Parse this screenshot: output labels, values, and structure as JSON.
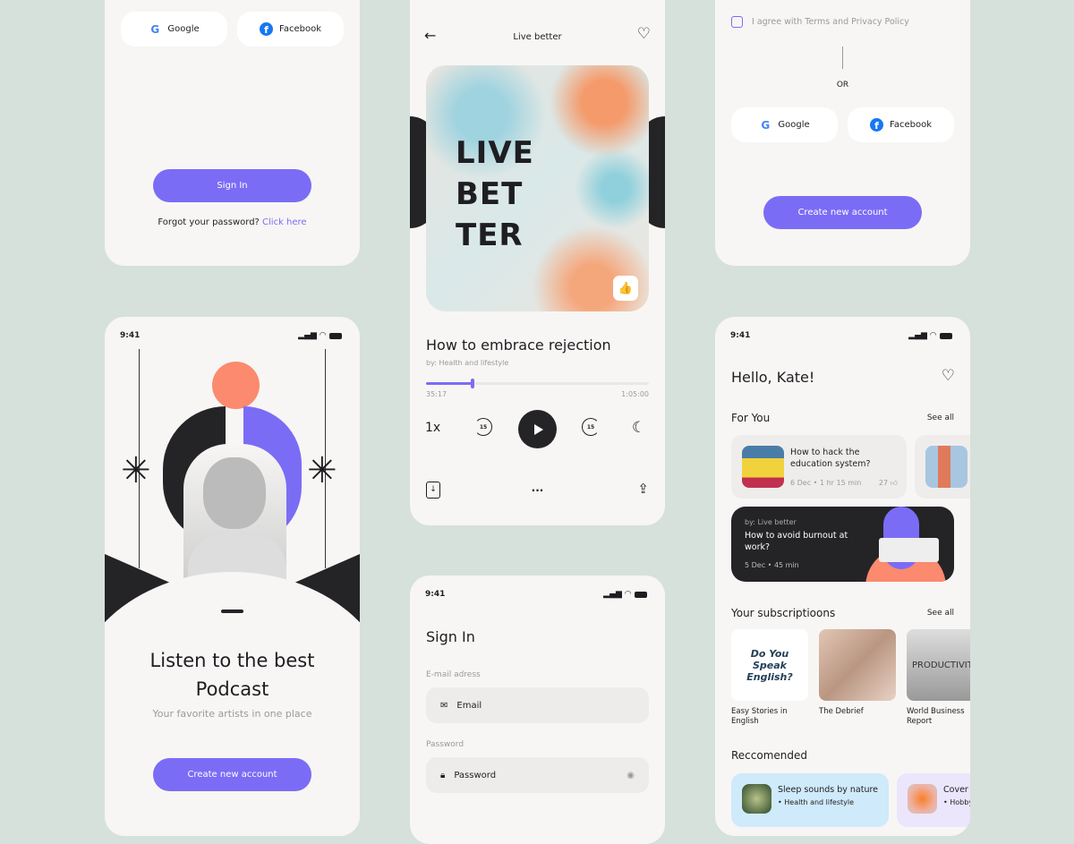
{
  "colors": {
    "accent": "#7b6cf6",
    "background": "#d6e1db",
    "card": "#f7f6f4",
    "dark": "#242427",
    "coral": "#fb8a6e"
  },
  "signin_top": {
    "google": "Google",
    "facebook": "Facebook",
    "signin": "Sign In",
    "forgot": "Forgot your password?",
    "click_here": "Click here"
  },
  "player": {
    "header_title": "Live better",
    "cover_text": [
      "LIVE",
      "BET",
      "TER"
    ],
    "title": "How to embrace rejection",
    "author": "by: Health and lifestyle",
    "elapsed": "35:17",
    "duration": "1:05:00",
    "progress_percent": 21,
    "speed": "1x",
    "skip_back": "15",
    "skip_forward": "15",
    "more": "..."
  },
  "register_top": {
    "agree": "I agree with Terms and Privacy Policy",
    "or": "OR",
    "google": "Google",
    "facebook": "Facebook",
    "create": "Create new account"
  },
  "onboarding": {
    "time": "9:41",
    "title_line1": "Listen to the best",
    "title_line2": "Podcast",
    "subtitle": "Your favorite artists in one place",
    "create": "Create new account"
  },
  "signin": {
    "time": "9:41",
    "title": "Sign In",
    "email_label": "E-mail adress",
    "email_placeholder": "Email",
    "password_label": "Password",
    "password_placeholder": "Password"
  },
  "home": {
    "time": "9:41",
    "greeting": "Hello, Kate!",
    "for_you": "For You",
    "see_all": "See all",
    "for_you_items": [
      {
        "title": "How to hack the education system?",
        "date": "6 Dec",
        "length": "1 hr 15 min",
        "likes": "27"
      }
    ],
    "featured": {
      "author": "by: Live better",
      "title": "How to avoid burnout at work?",
      "date": "5 Dec",
      "length": "45 min"
    },
    "subscriptions_title": "Your subscriptioons",
    "subscriptions": [
      {
        "name": "Easy Stories in English",
        "art_text": "Do You Speak English?"
      },
      {
        "name": "The Debrief"
      },
      {
        "name": "World Business Report",
        "art_text": "PRODUCTIVITY"
      }
    ],
    "recommended_title": "Reccomended",
    "recommended": [
      {
        "title": "Sleep sounds by nature",
        "tag": "• Health and lifestyle"
      },
      {
        "title": "Cover",
        "tag": "• Hobby"
      }
    ]
  }
}
